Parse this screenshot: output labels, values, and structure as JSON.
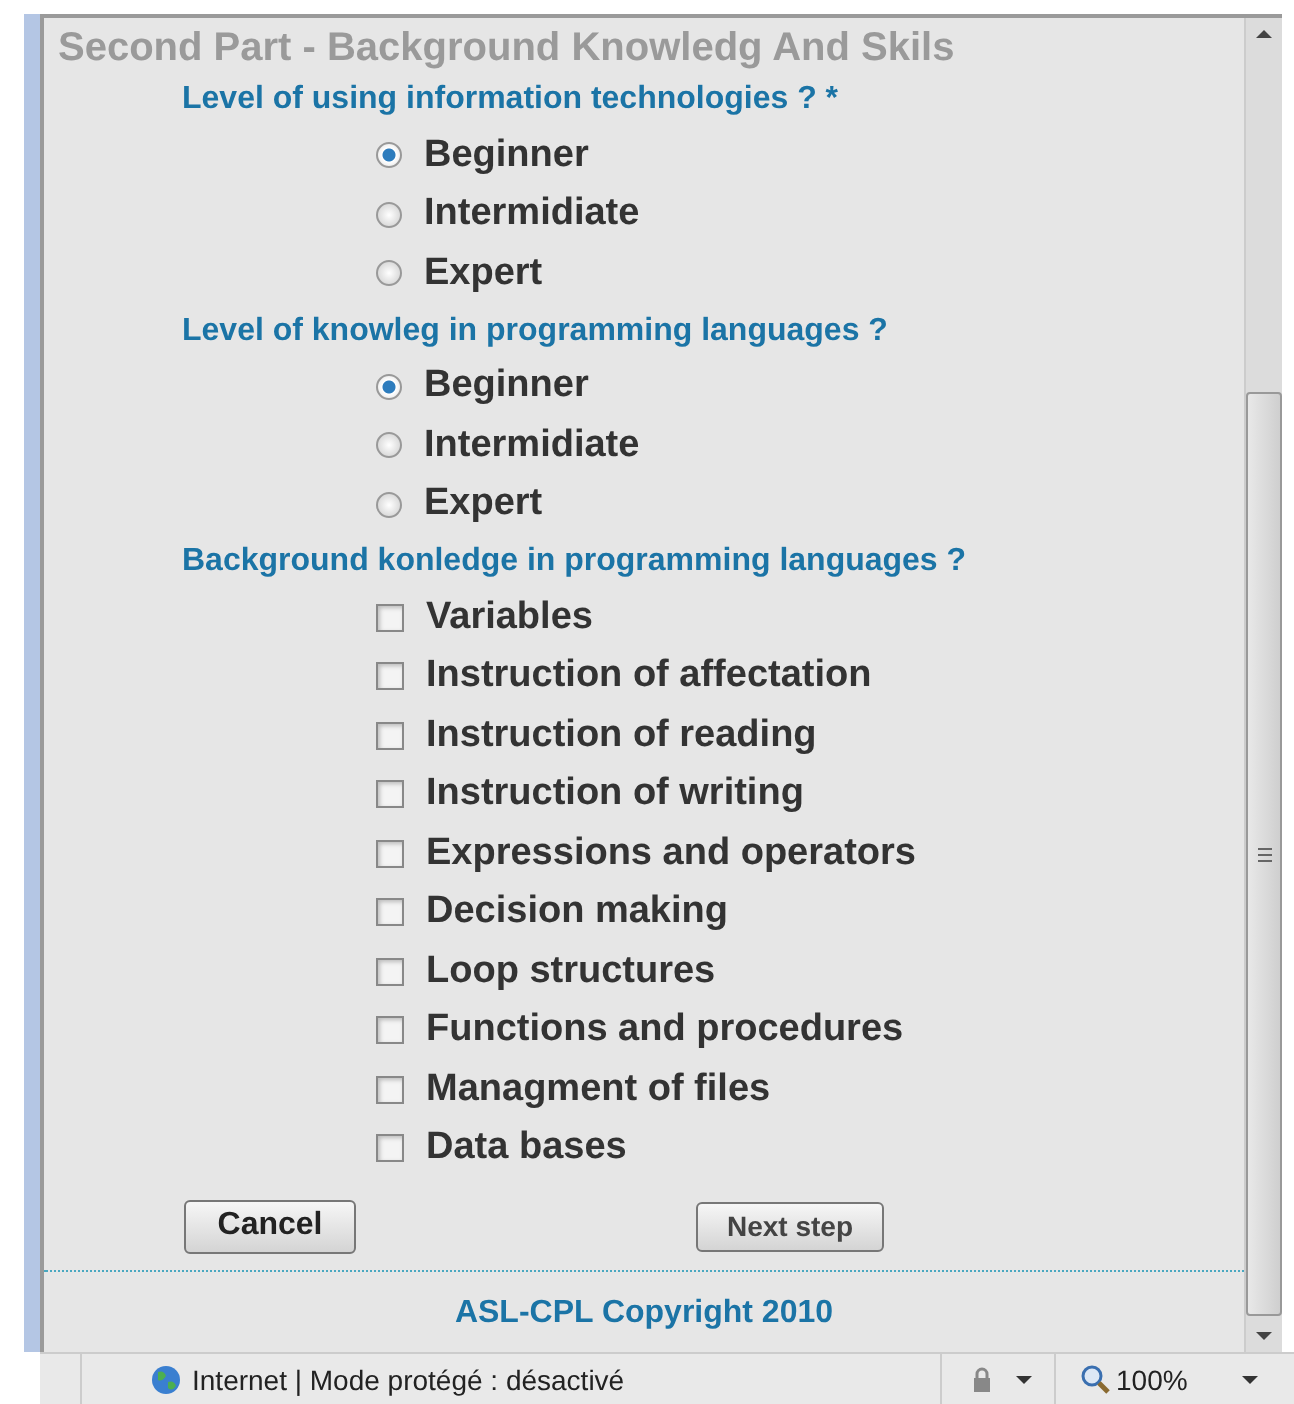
{
  "title": "Second Part - Background Knowledg And Skils",
  "questions": [
    {
      "kind": "radio",
      "label": "Level of using information technologies ? *",
      "options": [
        {
          "label": "Beginner",
          "selected": true
        },
        {
          "label": "Intermidiate",
          "selected": false
        },
        {
          "label": "Expert",
          "selected": false
        }
      ]
    },
    {
      "kind": "radio",
      "label": "Level of knowleg in programming languages ?",
      "options": [
        {
          "label": "Beginner",
          "selected": true
        },
        {
          "label": "Intermidiate",
          "selected": false
        },
        {
          "label": "Expert",
          "selected": false
        }
      ]
    },
    {
      "kind": "checkbox",
      "label": "Background konledge in programming languages ?",
      "options": [
        {
          "label": "Variables",
          "checked": false
        },
        {
          "label": "Instruction of affectation",
          "checked": false
        },
        {
          "label": "Instruction of reading",
          "checked": false
        },
        {
          "label": "Instruction of writing",
          "checked": false
        },
        {
          "label": "Expressions and operators",
          "checked": false
        },
        {
          "label": "Decision making",
          "checked": false
        },
        {
          "label": "Loop structures",
          "checked": false
        },
        {
          "label": "Functions and procedures",
          "checked": false
        },
        {
          "label": "Managment of files",
          "checked": false
        },
        {
          "label": "Data bases",
          "checked": false
        }
      ]
    }
  ],
  "buttons": {
    "cancel": "Cancel",
    "next": "Next step"
  },
  "footer": "ASL-CPL Copyright 2010",
  "status_bar": {
    "zone": "Internet | Mode protégé : désactivé",
    "zoom": "100%"
  }
}
